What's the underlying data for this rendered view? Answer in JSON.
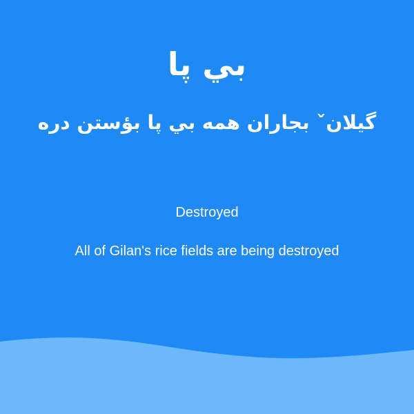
{
  "card": {
    "title": "بي پا",
    "subtitle": "گيلانˇ بجاران همه بي پا بؤستن دره",
    "gloss": "Destroyed",
    "translation": "All of Gilan's rice fields are being destroyed"
  },
  "colors": {
    "background": "#1f8af5",
    "wave": "#6db8fb",
    "text": "#ffffff"
  }
}
